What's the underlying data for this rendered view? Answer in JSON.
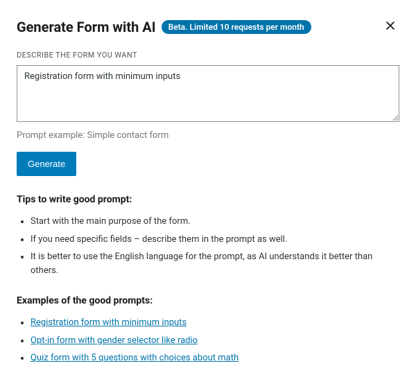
{
  "header": {
    "title": "Generate Form with AI",
    "badge": "Beta. Limited 10 requests per month"
  },
  "form": {
    "label": "DESCRIBE THE FORM YOU WANT",
    "value": "Registration form with minimum inputs",
    "hint": "Prompt example: Simple contact form",
    "button": "Generate"
  },
  "tips": {
    "heading": "Tips to write good prompt:",
    "items": [
      "Start with the main purpose of the form.",
      "If you need specific fields – describe them in the prompt as well.",
      "It is better to use the English language for the prompt, as AI understands it better than others."
    ]
  },
  "examples": {
    "heading": "Examples of the good prompts:",
    "items": [
      "Registration form with minimum inputs",
      "Opt-in form with gender selector like radio",
      "Quiz form with 5 questions with choices about math"
    ]
  }
}
